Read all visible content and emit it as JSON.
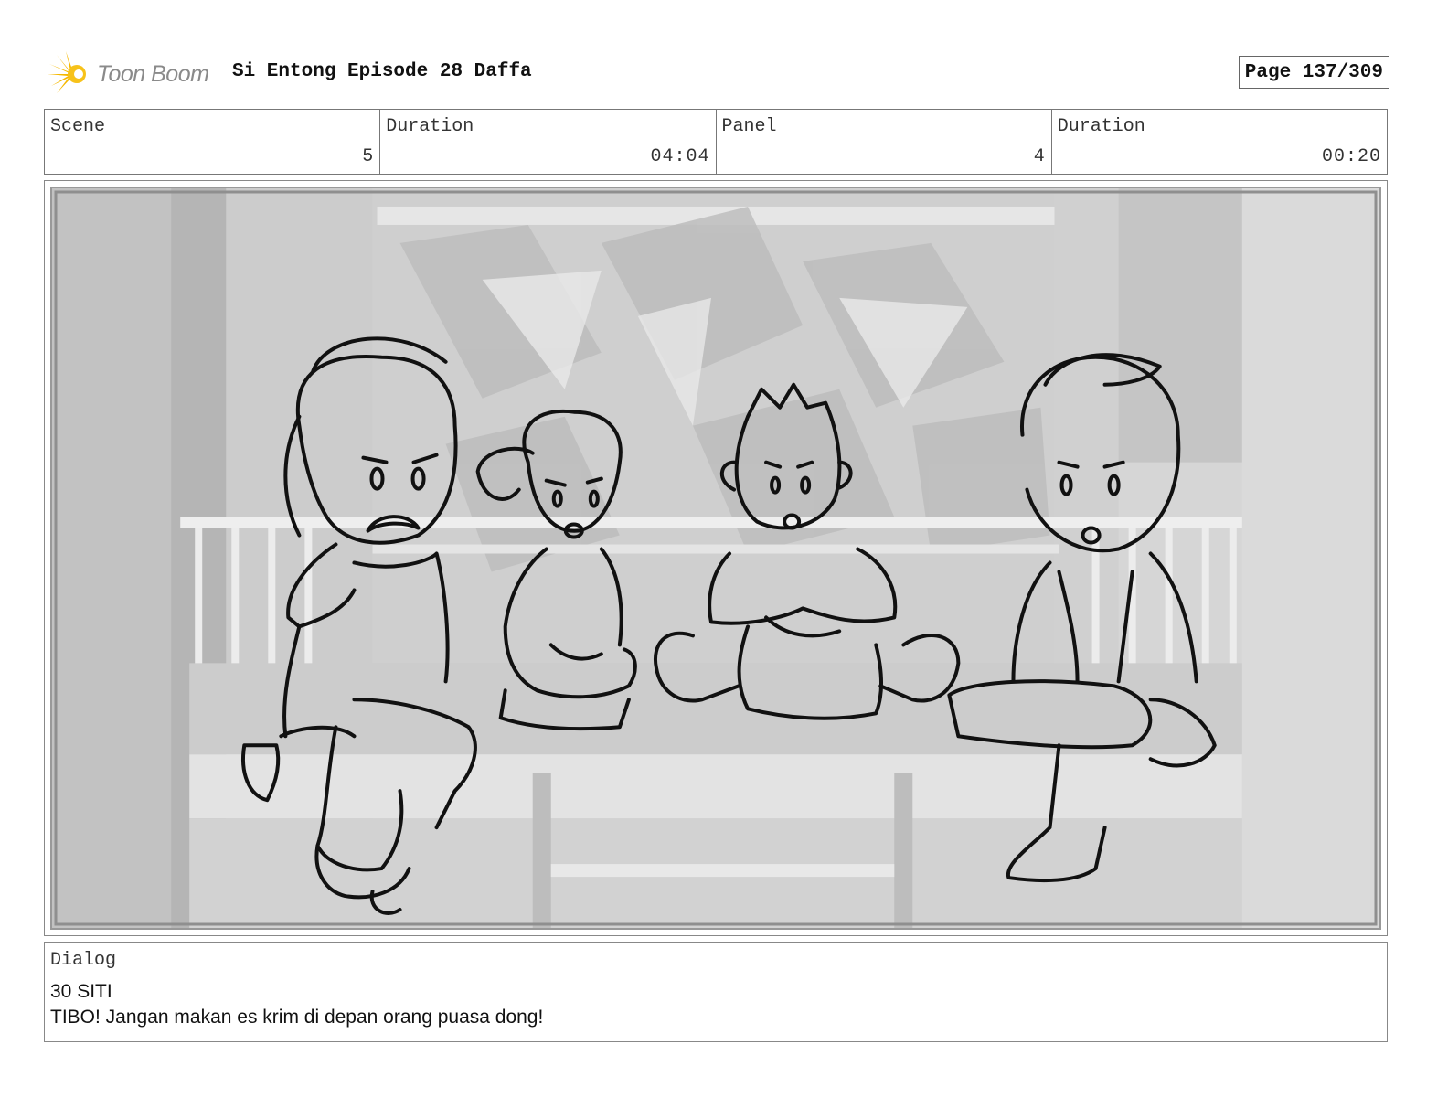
{
  "header": {
    "logo_text": "Toon Boom",
    "title": "Si Entong Episode 28 Daffa",
    "page": "Page 137/309"
  },
  "info": {
    "scene_label": "Scene",
    "scene_value": "5",
    "scene_duration_label": "Duration",
    "scene_duration_value": "04:04",
    "panel_label": "Panel",
    "panel_value": "4",
    "panel_duration_label": "Duration",
    "panel_duration_value": "00:20"
  },
  "panel": {
    "image_icon": "storyboard-sketch"
  },
  "dialog": {
    "label": "Dialog",
    "line1": "30 SITI",
    "line2": "TIBO! Jangan makan es krim di depan orang puasa dong!"
  },
  "colors": {
    "logo_accent": "#f5b800",
    "border": "#777777",
    "background_render": "#d9d9d9"
  }
}
